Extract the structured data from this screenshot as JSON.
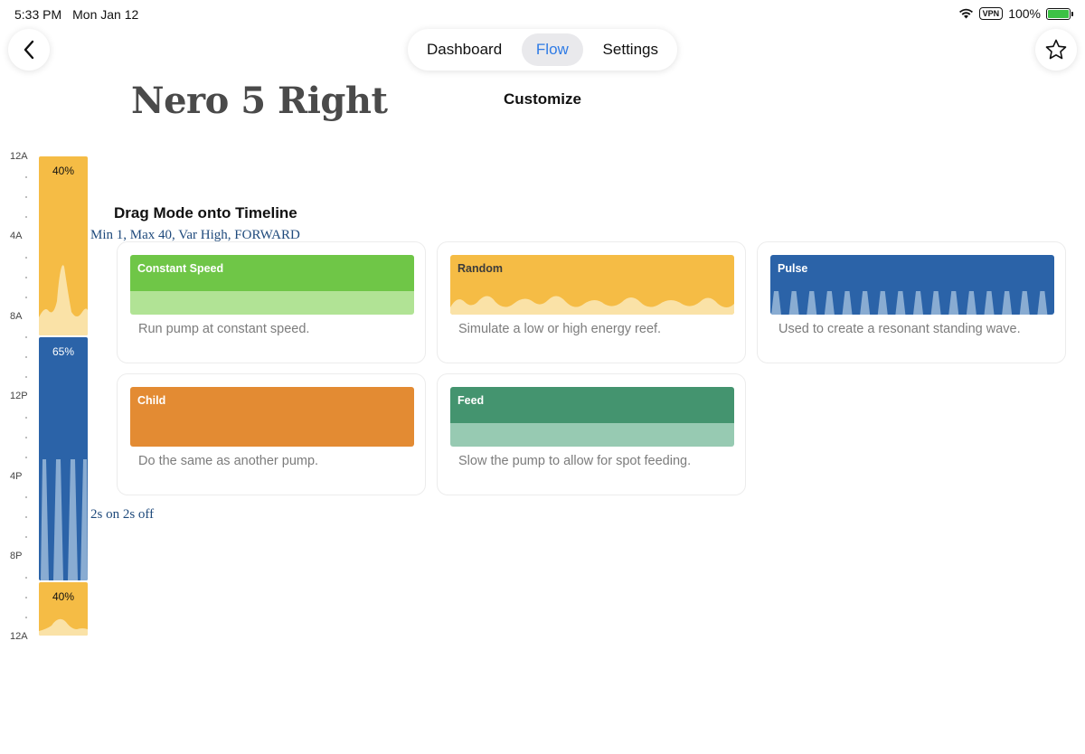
{
  "status": {
    "time": "5:33 PM",
    "date": "Mon Jan 12",
    "vpn": "VPN",
    "battery": "100%"
  },
  "nav": {
    "tabs": [
      {
        "label": "Dashboard",
        "active": false
      },
      {
        "label": "Flow",
        "active": true
      },
      {
        "label": "Settings",
        "active": false
      }
    ],
    "subtitle": "Customize"
  },
  "pump": {
    "name": "Nero 5 Right"
  },
  "timeline": {
    "ticks": [
      "12A",
      "4A",
      "8A",
      "12P",
      "4P",
      "8P",
      "12A"
    ],
    "segments": [
      {
        "label": "40%",
        "color": "#f5bc45",
        "note": "Min 1, Max 40, Var High, FORWARD"
      },
      {
        "label": "65%",
        "color": "#2b63a8",
        "note": "2s on 2s off"
      },
      {
        "label": "40%",
        "color": "#f5bc45"
      }
    ]
  },
  "modes": {
    "heading": "Drag Mode onto Timeline",
    "cards": [
      {
        "name": "Constant Speed",
        "description": "Run pump at constant speed.",
        "color": "#6fc647",
        "light": "#b1e395"
      },
      {
        "name": "Random",
        "description": "Simulate a low or high energy reef.",
        "color": "#f5bc45",
        "light": "#fae2a7"
      },
      {
        "name": "Pulse",
        "description": "Used to create a resonant standing wave.",
        "color": "#2b63a8",
        "light": "#89acd2"
      },
      {
        "name": "Child",
        "description": "Do the same as another pump.",
        "color": "#e38b33",
        "light": "#e38b33"
      },
      {
        "name": "Feed",
        "description": "Slow the pump to allow for spot feeding.",
        "color": "#44946f",
        "light": "#97cab2"
      }
    ]
  }
}
